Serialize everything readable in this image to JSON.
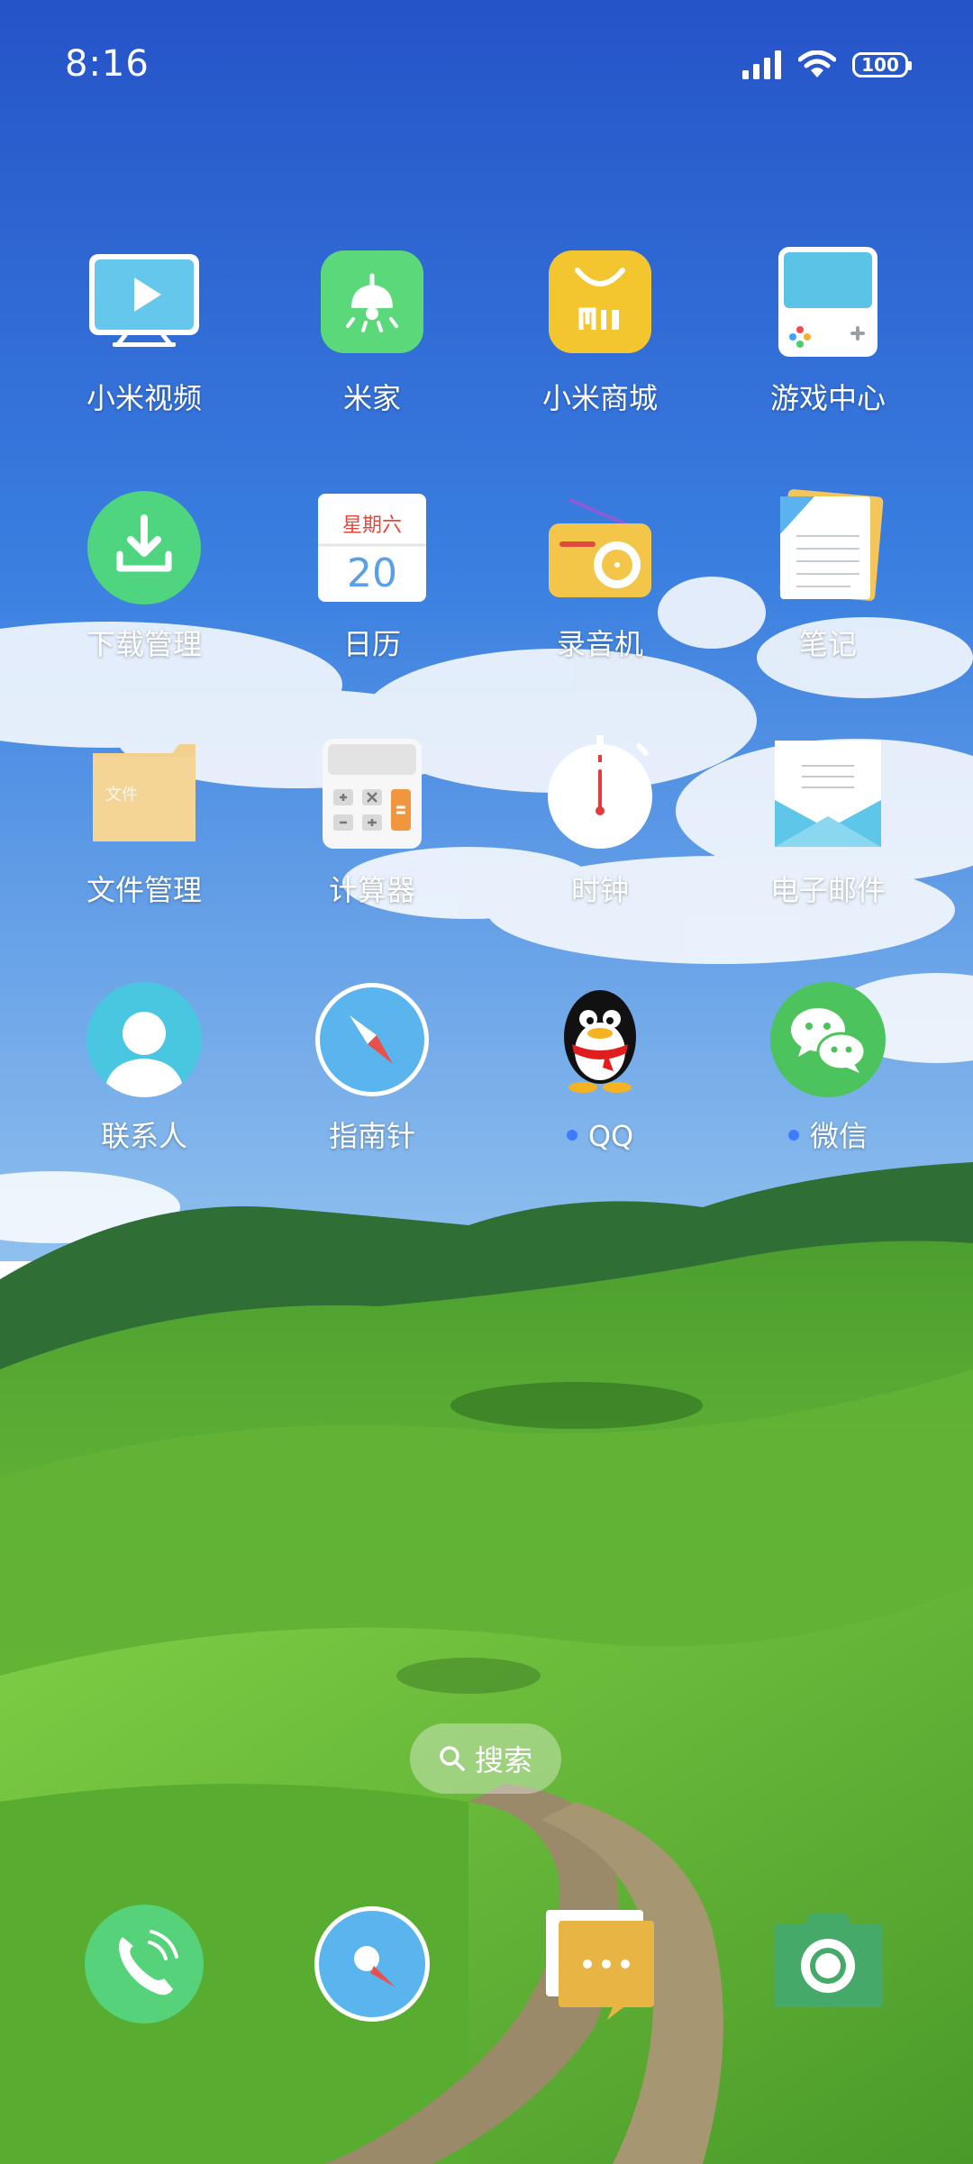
{
  "status_bar": {
    "time": "8:16",
    "battery": "100",
    "icons": [
      "signal-icon",
      "wifi-icon",
      "battery-icon"
    ]
  },
  "apps": [
    {
      "label": "小米视频",
      "icon": "tv-play-icon"
    },
    {
      "label": "米家",
      "icon": "lamp-icon"
    },
    {
      "label": "小米商城",
      "icon": "shopping-bag-mi-icon"
    },
    {
      "label": "游戏中心",
      "icon": "game-console-icon"
    },
    {
      "label": "下载管理",
      "icon": "download-icon"
    },
    {
      "label": "日历",
      "icon": "calendar-icon",
      "calendar_weekday": "星期六",
      "calendar_day": "20"
    },
    {
      "label": "录音机",
      "icon": "radio-icon"
    },
    {
      "label": "笔记",
      "icon": "notes-icon"
    },
    {
      "label": "文件管理",
      "icon": "folder-icon",
      "folder_text": "文件"
    },
    {
      "label": "计算器",
      "icon": "calculator-icon"
    },
    {
      "label": "时钟",
      "icon": "stopwatch-icon"
    },
    {
      "label": "电子邮件",
      "icon": "envelope-icon"
    },
    {
      "label": "联系人",
      "icon": "contact-person-icon"
    },
    {
      "label": "指南针",
      "icon": "compass-icon"
    },
    {
      "label": "QQ",
      "icon": "qq-penguin-icon",
      "new_indicator": true
    },
    {
      "label": "微信",
      "icon": "wechat-icon",
      "new_indicator": true
    }
  ],
  "search": {
    "label": "搜索"
  },
  "dock": [
    {
      "name": "phone",
      "icon": "phone-icon"
    },
    {
      "name": "browser",
      "icon": "browser-icon"
    },
    {
      "name": "messages",
      "icon": "messages-icon"
    },
    {
      "name": "camera",
      "icon": "camera-icon"
    }
  ],
  "colors": {
    "sky_top": "#2a5fcf",
    "sky_bottom": "#7fb4ec",
    "hill_dark": "#2f6e35",
    "grass": "#6cbf3a",
    "notification_dot": "#3d7bff"
  }
}
